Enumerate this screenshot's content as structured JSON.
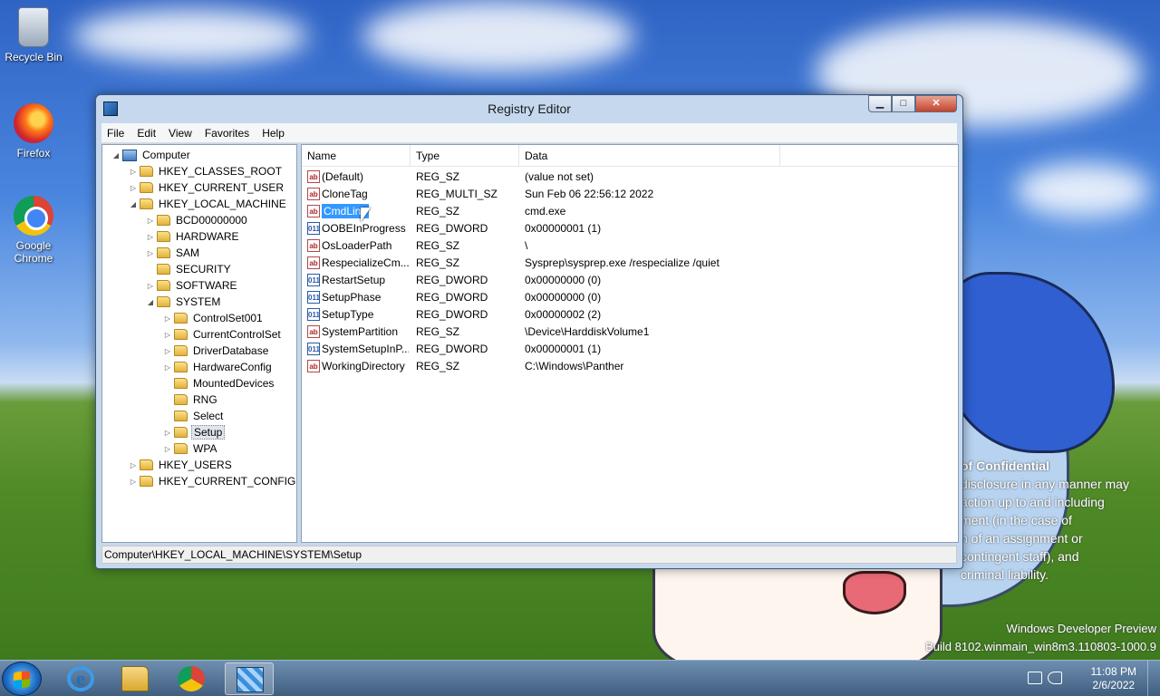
{
  "desktop": {
    "icons": [
      {
        "label": "Recycle Bin",
        "icon": "recycle-bin-icon"
      },
      {
        "label": "Firefox",
        "icon": "firefox-icon"
      },
      {
        "label": "Google Chrome",
        "icon": "chrome-icon"
      }
    ],
    "notice": {
      "heading": "of Confidential",
      "lines": [
        "disclosure in any manner may",
        "action up to and including",
        "ment (in the case of",
        "n of an assignment or",
        "contingent staff), and",
        "criminal liability."
      ]
    },
    "watermark": {
      "line1": "Windows Developer Preview",
      "line2": "Build 8102.winmain_win8m3.110803-1000.9"
    }
  },
  "window": {
    "title": "Registry Editor",
    "buttons": {
      "minimize": "▁",
      "maximize": "□",
      "close": "✕"
    },
    "menu": [
      "File",
      "Edit",
      "View",
      "Favorites",
      "Help"
    ],
    "tree": [
      {
        "label": "Computer",
        "level": 0,
        "arrow": "◢",
        "type": "computer"
      },
      {
        "label": "HKEY_CLASSES_ROOT",
        "level": 1,
        "arrow": "▷"
      },
      {
        "label": "HKEY_CURRENT_USER",
        "level": 1,
        "arrow": "▷"
      },
      {
        "label": "HKEY_LOCAL_MACHINE",
        "level": 1,
        "arrow": "◢"
      },
      {
        "label": "BCD00000000",
        "level": 2,
        "arrow": "▷"
      },
      {
        "label": "HARDWARE",
        "level": 2,
        "arrow": "▷"
      },
      {
        "label": "SAM",
        "level": 2,
        "arrow": "▷"
      },
      {
        "label": "SECURITY",
        "level": 2,
        "arrow": ""
      },
      {
        "label": "SOFTWARE",
        "level": 2,
        "arrow": "▷"
      },
      {
        "label": "SYSTEM",
        "level": 2,
        "arrow": "◢"
      },
      {
        "label": "ControlSet001",
        "level": 3,
        "arrow": "▷"
      },
      {
        "label": "CurrentControlSet",
        "level": 3,
        "arrow": "▷"
      },
      {
        "label": "DriverDatabase",
        "level": 3,
        "arrow": "▷"
      },
      {
        "label": "HardwareConfig",
        "level": 3,
        "arrow": "▷"
      },
      {
        "label": "MountedDevices",
        "level": 3,
        "arrow": ""
      },
      {
        "label": "RNG",
        "level": 3,
        "arrow": ""
      },
      {
        "label": "Select",
        "level": 3,
        "arrow": ""
      },
      {
        "label": "Setup",
        "level": 3,
        "arrow": "▷",
        "selected": true
      },
      {
        "label": "WPA",
        "level": 3,
        "arrow": "▷"
      },
      {
        "label": "HKEY_USERS",
        "level": 1,
        "arrow": "▷"
      },
      {
        "label": "HKEY_CURRENT_CONFIG",
        "level": 1,
        "arrow": "▷"
      }
    ],
    "columns": [
      "Name",
      "Type",
      "Data"
    ],
    "values": [
      {
        "name": "(Default)",
        "type": "REG_SZ",
        "data": "(value not set)",
        "icon": "ab"
      },
      {
        "name": "CloneTag",
        "type": "REG_MULTI_SZ",
        "data": "Sun Feb 06 22:56:12 2022",
        "icon": "ab"
      },
      {
        "name": "CmdLine",
        "type": "REG_SZ",
        "data": "cmd.exe",
        "icon": "ab",
        "selected": true
      },
      {
        "name": "OOBEInProgress",
        "type": "REG_DWORD",
        "data": "0x00000001 (1)",
        "icon": "bin"
      },
      {
        "name": "OsLoaderPath",
        "type": "REG_SZ",
        "data": "\\",
        "icon": "ab"
      },
      {
        "name": "RespecializeCm...",
        "type": "REG_SZ",
        "data": "Sysprep\\sysprep.exe /respecialize /quiet",
        "icon": "ab"
      },
      {
        "name": "RestartSetup",
        "type": "REG_DWORD",
        "data": "0x00000000 (0)",
        "icon": "bin"
      },
      {
        "name": "SetupPhase",
        "type": "REG_DWORD",
        "data": "0x00000000 (0)",
        "icon": "bin"
      },
      {
        "name": "SetupType",
        "type": "REG_DWORD",
        "data": "0x00000002 (2)",
        "icon": "bin"
      },
      {
        "name": "SystemPartition",
        "type": "REG_SZ",
        "data": "\\Device\\HarddiskVolume1",
        "icon": "ab"
      },
      {
        "name": "SystemSetupInP...",
        "type": "REG_DWORD",
        "data": "0x00000001 (1)",
        "icon": "bin"
      },
      {
        "name": "WorkingDirectory",
        "type": "REG_SZ",
        "data": "C:\\Windows\\Panther",
        "icon": "ab"
      }
    ],
    "status": "Computer\\HKEY_LOCAL_MACHINE\\SYSTEM\\Setup"
  },
  "taskbar": {
    "apps": [
      "internet-explorer-icon",
      "file-explorer-icon",
      "chrome-icon",
      "registry-editor-icon"
    ],
    "clock": {
      "time": "11:08 PM",
      "date": "2/6/2022"
    }
  },
  "colors": {
    "selection": "#3399ff",
    "titlebar": "#c5d8ee"
  }
}
